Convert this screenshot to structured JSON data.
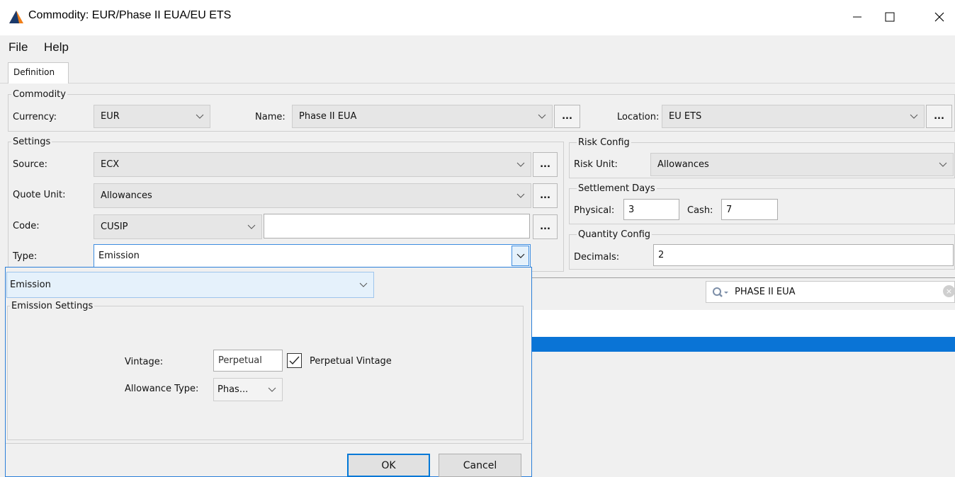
{
  "window": {
    "title": "Commodity: EUR/Phase II EUA/EU ETS",
    "icon": "app-logo-icon",
    "controls": [
      "minimize-icon",
      "maximize-icon",
      "close-icon"
    ]
  },
  "menu": [
    "File",
    "Help"
  ],
  "tabs": [
    {
      "label": "Definition",
      "active": true
    }
  ],
  "commodity": {
    "group_label": "Commodity",
    "currency_label": "Currency:",
    "currency_value": "EUR",
    "name_label": "Name:",
    "name_value": "Phase II EUA",
    "location_label": "Location:",
    "location_value": "EU ETS",
    "ellipsis": "..."
  },
  "settings": {
    "group_label": "Settings",
    "source_label": "Source:",
    "source_value": "ECX",
    "quote_unit_label": "Quote Unit:",
    "quote_unit_value": "Allowances",
    "code_label": "Code:",
    "code_value": "CUSIP",
    "code_text": "",
    "type_label": "Type:",
    "type_value": "Emission"
  },
  "risk_config": {
    "group_label": "Risk Config",
    "risk_unit_label": "Risk Unit:",
    "risk_unit_value": "Allowances"
  },
  "settlement_days": {
    "group_label": "Settlement Days",
    "physical_label": "Physical:",
    "physical_value": "3",
    "cash_label": "Cash:",
    "cash_value": "7"
  },
  "quantity_config": {
    "group_label": "Quantity Config",
    "decimals_label": "Decimals:",
    "decimals_value": "2"
  },
  "search": {
    "value": "PHASE II EUA"
  },
  "colors": {
    "accent": "#0078d7",
    "selected_row": "#0a74d6",
    "panel": "#f0f0f0"
  },
  "popup": {
    "type_value": "Emission",
    "group_label": "Emission Settings",
    "vintage_label": "Vintage:",
    "vintage_value": "Perpetual",
    "perpetual_checkbox_label": "Perpetual Vintage",
    "perpetual_checked": true,
    "allowance_type_label": "Allowance Type:",
    "allowance_type_value": "Phas...",
    "ok_label": "OK",
    "cancel_label": "Cancel"
  }
}
